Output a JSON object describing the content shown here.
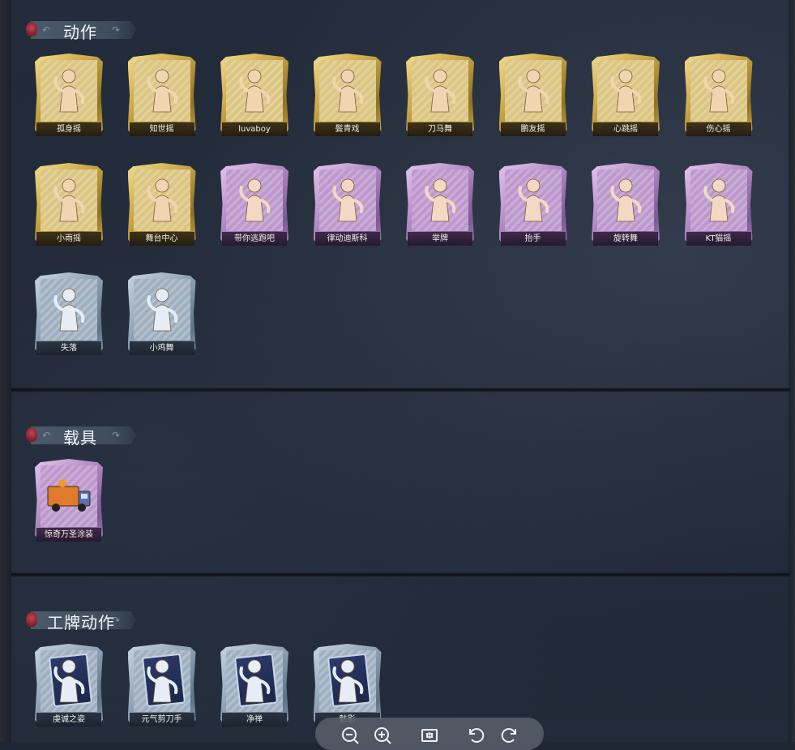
{
  "sections": {
    "actions": {
      "title": "动作",
      "items": [
        {
          "label": "孤身摇",
          "rarity": "gold",
          "icon": "figure-dance-icon"
        },
        {
          "label": "知世摇",
          "rarity": "gold",
          "icon": "figure-dance-icon"
        },
        {
          "label": "luvaboy",
          "rarity": "gold",
          "icon": "figure-dance-icon"
        },
        {
          "label": "鬓青戏",
          "rarity": "gold",
          "icon": "figure-dance-icon"
        },
        {
          "label": "刀马舞",
          "rarity": "gold",
          "icon": "figure-dance-icon"
        },
        {
          "label": "鹏友摇",
          "rarity": "gold",
          "icon": "figure-dance-icon"
        },
        {
          "label": "心跳摇",
          "rarity": "gold",
          "icon": "figure-dance-icon"
        },
        {
          "label": "伤心摇",
          "rarity": "gold",
          "icon": "figure-heart-icon"
        },
        {
          "label": "小雨摇",
          "rarity": "gold",
          "icon": "figure-dance-icon"
        },
        {
          "label": "舞台中心",
          "rarity": "gold",
          "icon": "figure-dance-icon"
        },
        {
          "label": "带你逃跑吧",
          "rarity": "purple",
          "icon": "figure-point-icon"
        },
        {
          "label": "律动迪斯科",
          "rarity": "purple",
          "icon": "figure-disco-icon"
        },
        {
          "label": "举牌",
          "rarity": "purple",
          "icon": "sign-holder-icon"
        },
        {
          "label": "抬手",
          "rarity": "purple",
          "icon": "figure-raise-hand-icon"
        },
        {
          "label": "旋转舞",
          "rarity": "purple",
          "icon": "figure-spin-icon"
        },
        {
          "label": "KT猫摇",
          "rarity": "purple",
          "icon": "figure-dance-icon"
        },
        {
          "label": "失落",
          "rarity": "blue",
          "icon": "figure-crawl-icon"
        },
        {
          "label": "小鸡舞",
          "rarity": "blue",
          "icon": "figure-chicken-icon"
        }
      ]
    },
    "vehicles": {
      "title": "载具",
      "items": [
        {
          "label": "惊奇万圣涂装",
          "rarity": "purple",
          "icon": "truck-icon"
        }
      ]
    },
    "badge_actions": {
      "title": "工牌动作",
      "items": [
        {
          "label": "虔诚之姿",
          "rarity": "blue",
          "icon": "badge-figure-icon"
        },
        {
          "label": "元气剪刀手",
          "rarity": "blue",
          "icon": "badge-figure-icon"
        },
        {
          "label": "净禅",
          "rarity": "blue",
          "icon": "badge-figure-icon"
        },
        {
          "label": "魅影",
          "rarity": "blue",
          "icon": "badge-figure-icon"
        }
      ]
    }
  },
  "toolbar": {
    "buttons": [
      "zoom-out-icon",
      "zoom-in-icon",
      "actual-size-icon",
      "rotate-left-icon",
      "rotate-right-icon"
    ]
  },
  "colors": {
    "gold": "#c9a646",
    "purple": "#b087c4",
    "blue": "#8ea2b5",
    "background": "#1f2735"
  }
}
